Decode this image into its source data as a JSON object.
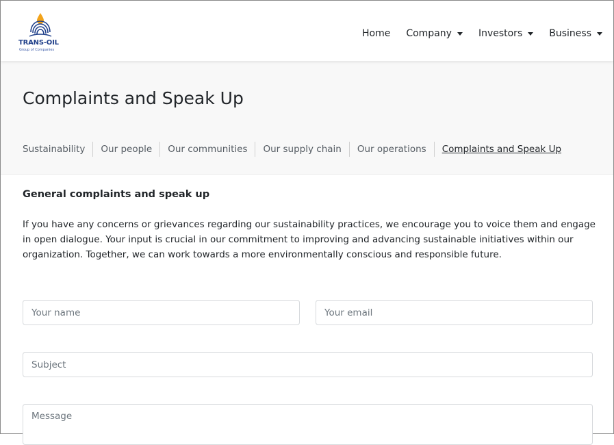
{
  "brand": {
    "name": "TRANS-OIL",
    "tagline": "Group of Companies",
    "colors": {
      "navy": "#1f3f8a",
      "orange": "#f2a31b"
    }
  },
  "nav": {
    "items": [
      {
        "label": "Home",
        "dropdown": false
      },
      {
        "label": "Company",
        "dropdown": true
      },
      {
        "label": "Investors",
        "dropdown": true
      },
      {
        "label": "Business",
        "dropdown": true
      }
    ]
  },
  "page": {
    "title": "Complaints and Speak Up"
  },
  "subnav": {
    "items": [
      {
        "label": "Sustainability",
        "active": false
      },
      {
        "label": "Our people",
        "active": false
      },
      {
        "label": "Our communities",
        "active": false
      },
      {
        "label": "Our supply chain",
        "active": false
      },
      {
        "label": "Our operations",
        "active": false
      },
      {
        "label": "Complaints and Speak Up",
        "active": true
      }
    ]
  },
  "content": {
    "heading": "General complaints and speak up",
    "intro": "If you have any concerns or grievances regarding our sustainability practices, we encourage you to voice them and engage in open dialogue. Your input is crucial in our commitment to improving and advancing sustainable initiatives within our organization. Together, we can work towards a more environmentally conscious and responsible future."
  },
  "form": {
    "name_placeholder": "Your name",
    "email_placeholder": "Your email",
    "subject_placeholder": "Subject",
    "message_placeholder": "Message"
  }
}
